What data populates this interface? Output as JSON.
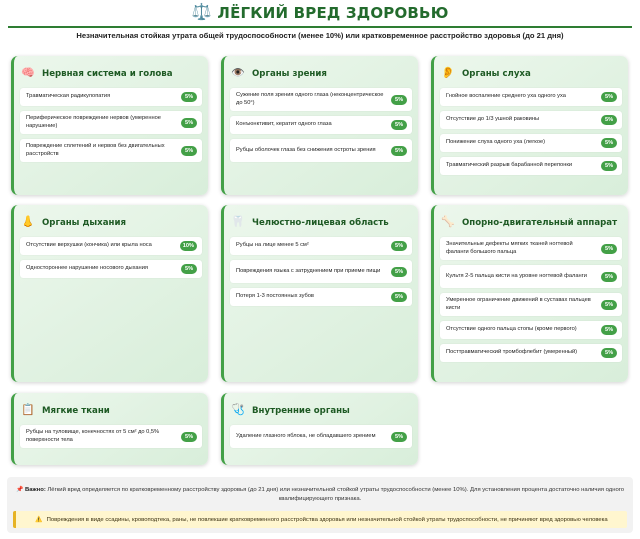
{
  "header": {
    "icon": "scales-icon",
    "title": "ЛЁГКИЙ ВРЕД ЗДОРОВЬЮ",
    "subtitle": "Незначительная стойкая утрата общей трудоспособности (менее 10%) или кратковременное расстройство здоровья (до 21 дня)"
  },
  "colors": {
    "accent": "#2e7d32",
    "badge": "#43a047",
    "card_bg": "#e3f2e3",
    "warning_bg": "#fff6cf"
  },
  "cards": [
    {
      "icon": "brain-icon",
      "title": "Нервная система и голова",
      "items": [
        {
          "label": "Травматическая радикулопатия",
          "percent": "5%"
        },
        {
          "label": "Периферическое повреждение нервов (умеренное нарушение)",
          "percent": "5%"
        },
        {
          "label": "Повреждение сплетений и нервов без двигательных расстройств",
          "percent": "5%"
        }
      ]
    },
    {
      "icon": "eye-icon",
      "title": "Органы зрения",
      "items": [
        {
          "label": "Сужение поля зрения одного глаза (неконцентрическое до 50°)",
          "percent": "5%"
        },
        {
          "label": "Конъюнктивит, кератит одного глаза",
          "percent": "5%"
        },
        {
          "label": "Рубцы оболочек глаза без снижения остроты зрения",
          "percent": "5%"
        }
      ]
    },
    {
      "icon": "ear-icon",
      "title": "Органы слуха",
      "items": [
        {
          "label": "Гнойное воспаление среднего уха одного уха",
          "percent": "5%"
        },
        {
          "label": "Отсутствие до 1/3 ушной раковины",
          "percent": "5%"
        },
        {
          "label": "Понижение слуха одного уха (легкое)",
          "percent": "5%"
        },
        {
          "label": "Травматический разрыв барабанной перепонки",
          "percent": "5%"
        }
      ]
    },
    {
      "icon": "nose-icon",
      "title": "Органы дыхания",
      "items": [
        {
          "label": "Отсутствие верхушки (кончика) или крыла носа",
          "percent": "10%"
        },
        {
          "label": "Одностороннее нарушение носового дыхания",
          "percent": "5%"
        }
      ]
    },
    {
      "icon": "tooth-icon",
      "title": "Челюстно-лицевая область",
      "items": [
        {
          "label": "Рубцы на лице менее 5 см²",
          "percent": "5%"
        },
        {
          "label": "Повреждения языка с затруднением при приеме пищи",
          "percent": "5%"
        },
        {
          "label": "Потеря 1-3 постоянных зубов",
          "percent": "5%"
        }
      ]
    },
    {
      "icon": "bone-icon",
      "title": "Опорно-двигательный аппарат",
      "items": [
        {
          "label": "Значительные дефекты мягких тканей ногтевой фаланги большого пальца",
          "percent": "5%"
        },
        {
          "label": "Культя 2-5 пальца кисти на уровне ногтевой фаланги",
          "percent": "5%"
        },
        {
          "label": "Умеренное ограничение движений в суставах пальцев кисти",
          "percent": "5%"
        },
        {
          "label": "Отсутствие одного пальца стопы (кроме первого)",
          "percent": "5%"
        },
        {
          "label": "Посттравматический тромбофлебит (умеренный)",
          "percent": "5%"
        }
      ]
    },
    {
      "icon": "clipboard-icon",
      "title": "Мягкие ткани",
      "items": [
        {
          "label": "Рубцы на туловище, конечностях от 5 см² до 0,5% поверхности тела",
          "percent": "5%"
        }
      ]
    },
    {
      "icon": "stethoscope-icon",
      "title": "Внутренние органы",
      "items": [
        {
          "label": "Удаление глазного яблока, не обладавшего зрением",
          "percent": "5%"
        }
      ]
    }
  ],
  "note": {
    "icon": "pushpin-icon",
    "important_label": "Важно:",
    "important_text": "Лёгкий вред определяется по кратковременному расстройству здоровья (до 21 дня) или незначительной стойкой утраты трудоспособности (менее 10%). Для установления процента достаточно наличия одного квалифицирующего признака.",
    "warning_icon": "warning-icon",
    "warning_text": "Повреждения в виде ссадины, кровоподтека, раны, не повлекшие кратковременного расстройства здоровья или незначительной стойкой утраты трудоспособности, не причиняют вред здоровью человека"
  }
}
